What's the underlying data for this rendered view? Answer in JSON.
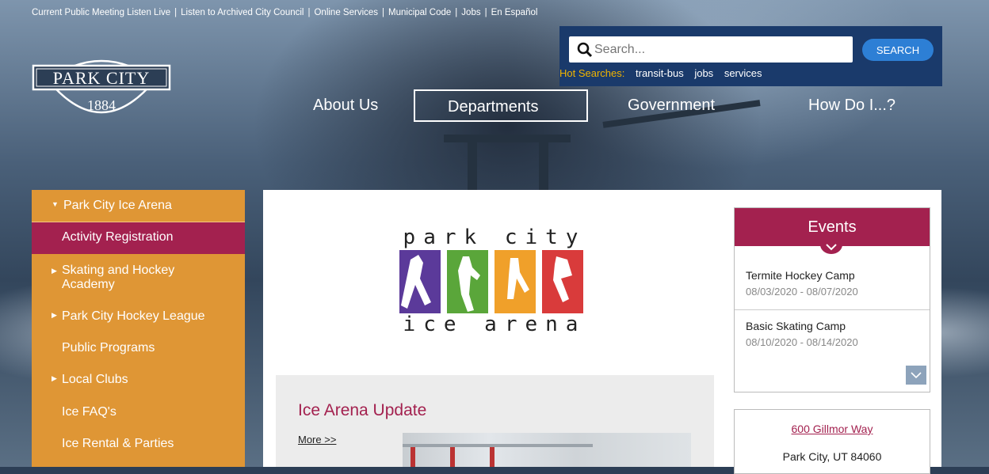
{
  "utility_links": [
    "Current Public Meeting Listen Live",
    "Listen to Archived City Council",
    "Online Services",
    "Municipal Code",
    "Jobs",
    "En Español"
  ],
  "utility_separator": "|",
  "logo": {
    "name": "PARK CITY",
    "year": "1884"
  },
  "search": {
    "placeholder": "Search...",
    "button": "SEARCH",
    "hot_label": "Hot Searches:",
    "hot_terms": [
      "transit-bus",
      "jobs",
      "services"
    ]
  },
  "nav": {
    "items": [
      "About Us",
      "Departments",
      "Government",
      "How Do I...?"
    ],
    "active": "Departments"
  },
  "sidebar": {
    "items": [
      {
        "label": "Park City Ice Arena",
        "expanded": true
      },
      {
        "label": "Activity Registration",
        "active": true
      },
      {
        "label": "Skating and Hockey Academy",
        "has_children": true
      },
      {
        "label": "Park City Hockey League",
        "has_children": true
      },
      {
        "label": "Public Programs"
      },
      {
        "label": "Local Clubs",
        "has_children": true
      },
      {
        "label": "Ice FAQ's"
      },
      {
        "label": "Ice Rental & Parties"
      }
    ]
  },
  "arena_logo": {
    "line1": "park city",
    "line2": "ice arena",
    "figure_colors": [
      "#5b3a9a",
      "#5aa63a",
      "#f0a02a",
      "#d93b3b"
    ]
  },
  "update": {
    "title": "Ice Arena Update",
    "more": "More >>"
  },
  "events": {
    "title": "Events",
    "items": [
      {
        "title": "Termite Hockey Camp",
        "dates": "08/03/2020 - 08/07/2020"
      },
      {
        "title": "Basic Skating Camp",
        "dates": "08/10/2020 - 08/14/2020"
      }
    ]
  },
  "address": {
    "street": "600 Gillmor Way",
    "city": "Park City, UT 84060"
  },
  "colors": {
    "accent": "#a3214f",
    "sidebar": "#df9635",
    "search_panel": "#1a3a6b",
    "search_button": "#2d7fd5",
    "hot_label": "#f0b400"
  }
}
